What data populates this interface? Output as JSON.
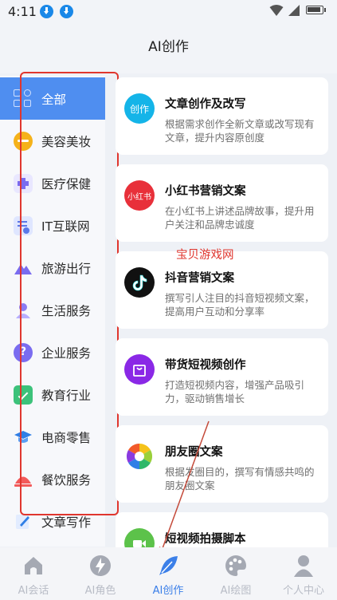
{
  "status_bar": {
    "time": "4:11"
  },
  "header": {
    "title": "AI创作"
  },
  "sidebar": {
    "items": [
      {
        "label": "全部",
        "icon": "grid-icon",
        "active": true
      },
      {
        "label": "美容美妆",
        "icon": "makeup-icon"
      },
      {
        "label": "医疗保健",
        "icon": "medical-icon"
      },
      {
        "label": "IT互联网",
        "icon": "internet-icon"
      },
      {
        "label": "旅游出行",
        "icon": "travel-icon"
      },
      {
        "label": "生活服务",
        "icon": "life-service-icon"
      },
      {
        "label": "企业服务",
        "icon": "enterprise-icon"
      },
      {
        "label": "教育行业",
        "icon": "education-icon"
      },
      {
        "label": "电商零售",
        "icon": "ecommerce-icon"
      },
      {
        "label": "餐饮服务",
        "icon": "catering-icon"
      },
      {
        "label": "文章写作",
        "icon": "writing-icon"
      }
    ]
  },
  "cards": [
    {
      "title": "文章创作及改写",
      "desc": "根据需求创作全新文章或改写现有文章，提升内容原创度",
      "icon_text": "创作",
      "icon": "article-icon",
      "color": "#14b4e8"
    },
    {
      "title": "小红书营销文案",
      "desc": "在小红书上讲述品牌故事，提升用户关注和品牌忠诚度",
      "icon_text": "小红书",
      "icon": "xiaohongshu-icon",
      "color": "#e8303a"
    },
    {
      "title": "抖音营销文案",
      "desc": "撰写引人注目的抖音短视频文案，提高用户互动和分享率",
      "icon_text": "",
      "icon": "douyin-icon",
      "color": "#111111"
    },
    {
      "title": "带货短视频创作",
      "desc": "打造短视频内容，增强产品吸引力，驱动销售增长",
      "icon_text": "",
      "icon": "shopping-bag-icon",
      "color": "#8a28e6"
    },
    {
      "title": "朋友圈文案",
      "desc": "根据发圈目的，撰写有情感共鸣的朋友圈文案",
      "icon_text": "",
      "icon": "moments-icon",
      "color": "#ffffff"
    },
    {
      "title": "短视频拍摄脚本",
      "desc": "",
      "icon_text": "",
      "icon": "camera-icon",
      "color": "#5cc24a"
    }
  ],
  "watermark": "宝贝游戏网",
  "tabbar": {
    "items": [
      {
        "label": "AI会话",
        "icon": "home-icon"
      },
      {
        "label": "AI角色",
        "icon": "lightning-icon"
      },
      {
        "label": "AI创作",
        "icon": "feather-icon",
        "active": true
      },
      {
        "label": "AI绘图",
        "icon": "palette-icon"
      },
      {
        "label": "个人中心",
        "icon": "person-icon"
      }
    ]
  },
  "colors": {
    "accent": "#4f8ef0",
    "annotation": "#e0362e",
    "tab_active": "#3b7fe8"
  }
}
